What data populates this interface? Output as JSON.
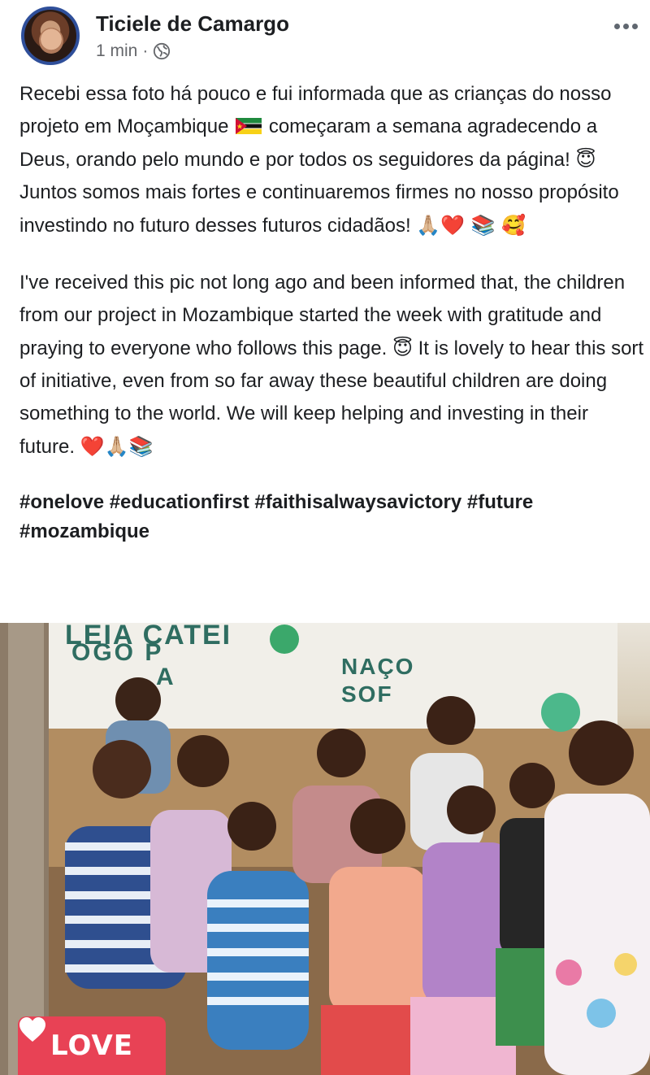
{
  "post": {
    "author": "Ticiele de Camargo",
    "time": "1 min",
    "separator": "·",
    "privacy_icon": "globe-icon",
    "more_icon": "more-dots-icon",
    "text_pt": {
      "part1": "Recebi essa foto há pouco e fui informada que as crianças do nosso projeto em Moçambique",
      "flag": "mozambique-flag",
      "part2": "começaram a semana agradecendo a Deus, orando pelo mundo e por todos os seguidores da página!",
      "emoji1": "😇",
      "part3": "Juntos somos mais fortes e continuaremos firmes no nosso propósito investindo no futuro desses futuros cidadãos!",
      "emoji_end": "🙏🏼❤️ 📚 🥰"
    },
    "text_en": {
      "part1": "I've received this pic not long ago and been informed that, the children from our project in Mozambique started the week with gratitude and praying to everyone who follows this page.",
      "emoji1": "😇",
      "part2": "It is lovely to hear this sort of initiative, even from so far away these beautiful children are doing something to the world. We will keep helping and investing in their future.",
      "emoji_end": "❤️🙏🏼📚"
    },
    "hashtags": "#onelove #educationfirst #faithisalwaysavictory #future #mozambique",
    "photo": {
      "banner_line1": "LEIA CATEI",
      "banner_line2": "OGO  P",
      "banner_line3": "NAÇO",
      "banner_line4": "SOF",
      "banner_line5": "A"
    },
    "reaction": {
      "label": "LOVE",
      "icon": "heart-icon",
      "color": "#e84255"
    }
  }
}
